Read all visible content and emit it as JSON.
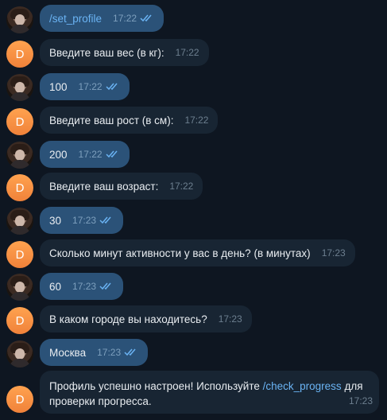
{
  "messages": [
    {
      "dir": "out",
      "text": "/set_profile",
      "time": "17:22",
      "cmd": true
    },
    {
      "dir": "in",
      "text": "Введите ваш вес (в кг):",
      "time": "17:22"
    },
    {
      "dir": "out",
      "text": "100",
      "time": "17:22"
    },
    {
      "dir": "in",
      "text": "Введите ваш рост (в см):",
      "time": "17:22"
    },
    {
      "dir": "out",
      "text": "200",
      "time": "17:22"
    },
    {
      "dir": "in",
      "text": "Введите ваш возраст:",
      "time": "17:22"
    },
    {
      "dir": "out",
      "text": "30",
      "time": "17:23"
    },
    {
      "dir": "in",
      "text": "Сколько минут активности у вас в день? (в минутах)",
      "time": "17:23"
    },
    {
      "dir": "out",
      "text": "60",
      "time": "17:23"
    },
    {
      "dir": "in",
      "text": "В каком городе вы находитесь?",
      "time": "17:23"
    },
    {
      "dir": "out",
      "text": "Москва",
      "time": "17:23"
    }
  ],
  "last_message": {
    "text_before": "Профиль успешно настроен! Используйте ",
    "link": "/check_progress",
    "text_after": " для",
    "line2": "проверки прогресса.",
    "time": "17:23"
  },
  "bot_avatar_letter": "D",
  "colors": {
    "background": "#0e1621",
    "outgoing_bubble": "#2b5278",
    "incoming_bubble": "#182533",
    "link": "#6ab3f3",
    "bot_avatar": "#f0823a"
  }
}
